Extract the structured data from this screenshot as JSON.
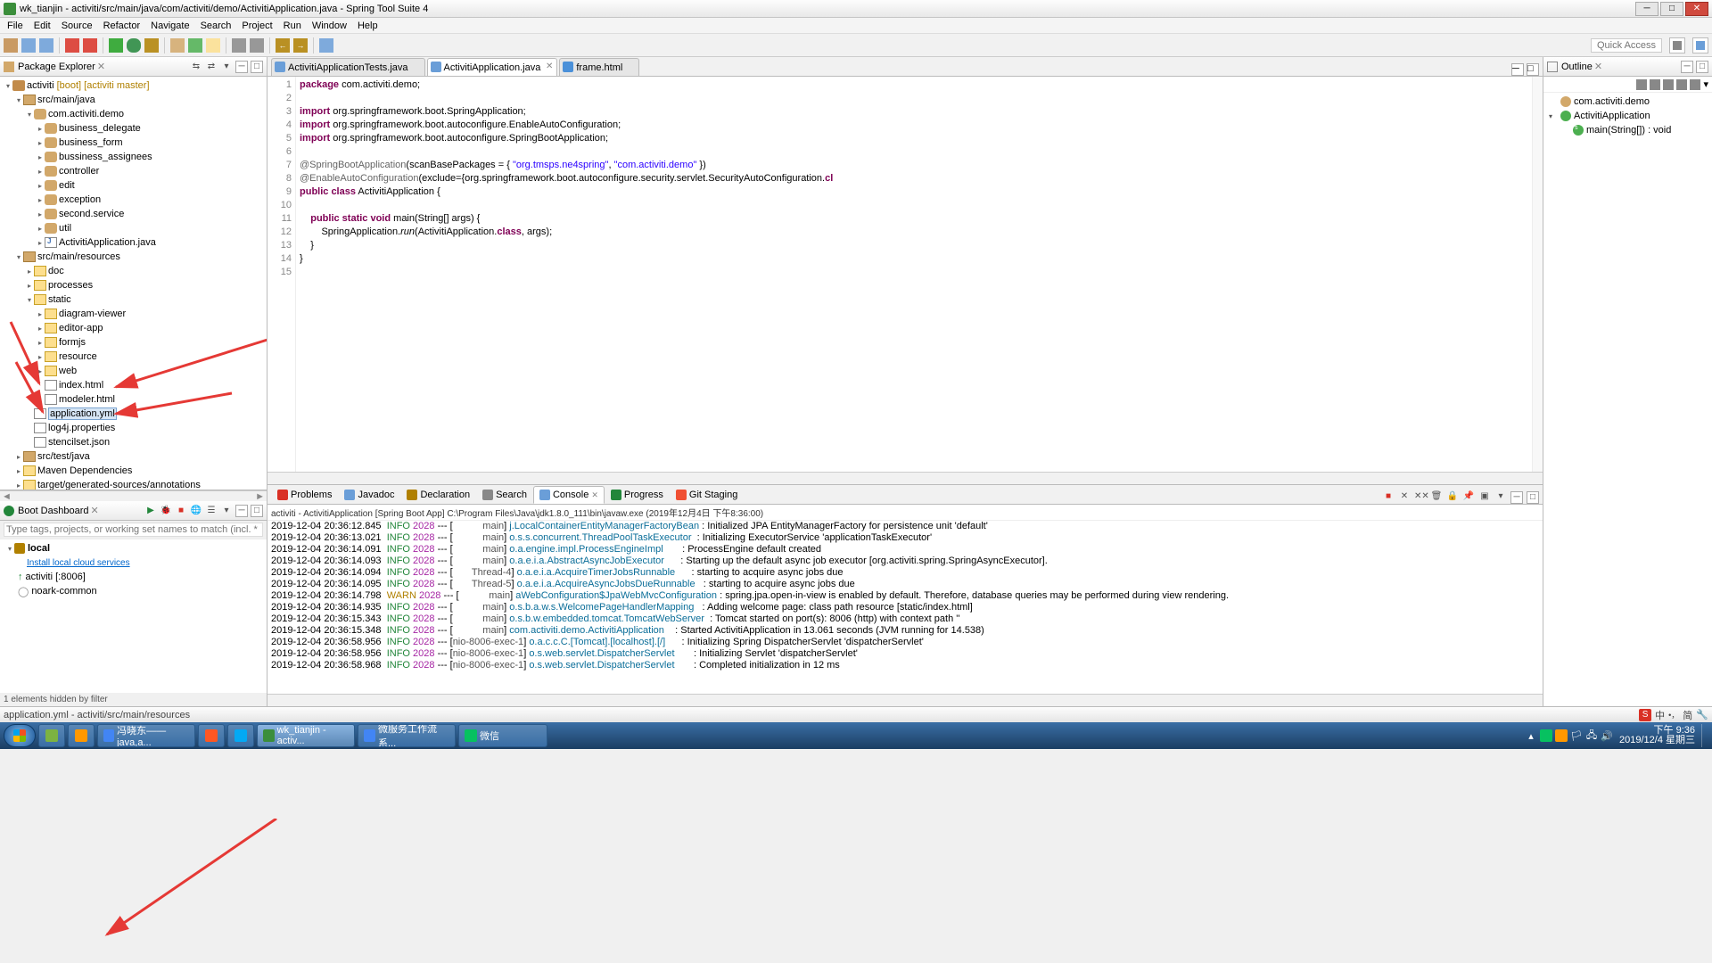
{
  "window": {
    "title": "wk_tianjin - activiti/src/main/java/com/activiti/demo/ActivitiApplication.java - Spring Tool Suite 4"
  },
  "menu": [
    "File",
    "Edit",
    "Source",
    "Refactor",
    "Navigate",
    "Search",
    "Project",
    "Run",
    "Window",
    "Help"
  ],
  "quick_access_placeholder": "Quick Access",
  "pkg_explorer": {
    "title": "Package Explorer",
    "project_label": "activiti",
    "project_tag1": "[boot]",
    "project_tag2": "[activiti master]",
    "nodes": {
      "src_main_java": "src/main/java",
      "pkg": "com.activiti.demo",
      "sub": [
        "business_delegate",
        "business_form",
        "bussiness_assignees",
        "controller",
        "edit",
        "exception",
        "second.service",
        "util"
      ],
      "app_java": "ActivitiApplication.java",
      "src_main_res": "src/main/resources",
      "doc": "doc",
      "processes": "processes",
      "static": "static",
      "static_children": [
        "diagram-viewer",
        "editor-app",
        "formjs",
        "resource",
        "web"
      ],
      "index_html": "index.html",
      "modeler_html": "modeler.html",
      "app_yml": "application.yml",
      "log4j": "log4j.properties",
      "stencil": "stencilset.json",
      "src_test": "src/test/java",
      "maven": "Maven Dependencies",
      "target": "target/generated-sources/annotations"
    }
  },
  "boot_dash": {
    "title": "Boot Dashboard",
    "filter_placeholder": "Type tags, projects, or working set names to match (incl. * and",
    "local": "local",
    "link": "Install local cloud services",
    "apps": [
      {
        "name": "activiti [:8006]",
        "state": "up"
      },
      {
        "name": "noark-common",
        "state": "down"
      }
    ],
    "hidden": "1 elements hidden by filter"
  },
  "editor_tabs": [
    {
      "label": "ActivitiApplicationTests.java",
      "icon": "ic-ja"
    },
    {
      "label": "ActivitiApplication.java",
      "icon": "ic-ja",
      "active": true
    },
    {
      "label": "frame.html",
      "icon": "ic-html"
    }
  ],
  "code_lines": [
    {
      "n": 1,
      "html": "<span class='kw'>package</span> com.activiti.demo;"
    },
    {
      "n": 2,
      "html": ""
    },
    {
      "n": 3,
      "html": "<span class='kw'>import</span> org.springframework.boot.SpringApplication;",
      "fold": true
    },
    {
      "n": 4,
      "html": "<span class='kw'>import</span> org.springframework.boot.autoconfigure.EnableAutoConfiguration;"
    },
    {
      "n": 5,
      "html": "<span class='kw'>import</span> org.springframework.boot.autoconfigure.SpringBootApplication;"
    },
    {
      "n": 6,
      "html": ""
    },
    {
      "n": 7,
      "html": "<span class='ann'>@SpringBootApplication</span>(scanBasePackages = { <span class='str'>\"org.tmsps.ne4spring\"</span>, <span class='str'>\"com.activiti.demo\"</span> })"
    },
    {
      "n": 8,
      "html": "<span class='ann'>@EnableAutoConfiguration</span>(exclude={org.springframework.boot.autoconfigure.security.servlet.SecurityAutoConfiguration.<span class='kw'>cl</span>"
    },
    {
      "n": 9,
      "html": "<span class='kw'>public class</span> ActivitiApplication {"
    },
    {
      "n": 10,
      "html": ""
    },
    {
      "n": 11,
      "html": "    <span class='kw'>public static void</span> main(String[] args) {",
      "fold": true
    },
    {
      "n": 12,
      "html": "        SpringApplication.<i>run</i>(ActivitiApplication.<span class='kw'>class</span>, args);"
    },
    {
      "n": 13,
      "html": "    }"
    },
    {
      "n": 14,
      "html": "}"
    },
    {
      "n": 15,
      "html": ""
    }
  ],
  "bottom_tabs": [
    "Problems",
    "Javadoc",
    "Declaration",
    "Search",
    "Console",
    "Progress",
    "Git Staging"
  ],
  "console_header": "activiti - ActivitiApplication [Spring Boot App] C:\\Program Files\\Java\\jdk1.8.0_111\\bin\\javaw.exe (2019年12月4日 下午8:36:00)",
  "console_lines": [
    {
      "ts": "2019-12-04 20:36:12.845",
      "lvl": "INFO",
      "pid": "2028",
      "thr": "           main",
      "logger": "j.LocalContainerEntityManagerFactoryBean",
      "msg": "Initialized JPA EntityManagerFactory for persistence unit 'default'"
    },
    {
      "ts": "2019-12-04 20:36:13.021",
      "lvl": "INFO",
      "pid": "2028",
      "thr": "           main",
      "logger": "o.s.s.concurrent.ThreadPoolTaskExecutor ",
      "msg": "Initializing ExecutorService 'applicationTaskExecutor'"
    },
    {
      "ts": "2019-12-04 20:36:14.091",
      "lvl": "INFO",
      "pid": "2028",
      "thr": "           main",
      "logger": "o.a.engine.impl.ProcessEngineImpl      ",
      "msg": "ProcessEngine default created"
    },
    {
      "ts": "2019-12-04 20:36:14.093",
      "lvl": "INFO",
      "pid": "2028",
      "thr": "           main",
      "logger": "o.a.e.i.a.AbstractAsyncJobExecutor     ",
      "msg": "Starting up the default async job executor [org.activiti.spring.SpringAsyncExecutor]."
    },
    {
      "ts": "2019-12-04 20:36:14.094",
      "lvl": "INFO",
      "pid": "2028",
      "thr": "       Thread-4",
      "logger": "o.a.e.i.a.AcquireTimerJobsRunnable     ",
      "msg": "starting to acquire async jobs due"
    },
    {
      "ts": "2019-12-04 20:36:14.095",
      "lvl": "INFO",
      "pid": "2028",
      "thr": "       Thread-5",
      "logger": "o.a.e.i.a.AcquireAsyncJobsDueRunnable  ",
      "msg": "starting to acquire async jobs due"
    },
    {
      "ts": "2019-12-04 20:36:14.798",
      "lvl": "WARN",
      "pid": "2028",
      "thr": "           main",
      "logger": "aWebConfiguration$JpaWebMvcConfiguration",
      "msg": "spring.jpa.open-in-view is enabled by default. Therefore, database queries may be performed during view rendering."
    },
    {
      "ts": "2019-12-04 20:36:14.935",
      "lvl": "INFO",
      "pid": "2028",
      "thr": "           main",
      "logger": "o.s.b.a.w.s.WelcomePageHandlerMapping  ",
      "msg": "Adding welcome page: class path resource [static/index.html]"
    },
    {
      "ts": "2019-12-04 20:36:15.343",
      "lvl": "INFO",
      "pid": "2028",
      "thr": "           main",
      "logger": "o.s.b.w.embedded.tomcat.TomcatWebServer ",
      "msg": "Tomcat started on port(s): 8006 (http) with context path ''"
    },
    {
      "ts": "2019-12-04 20:36:15.348",
      "lvl": "INFO",
      "pid": "2028",
      "thr": "           main",
      "logger": "com.activiti.demo.ActivitiApplication   ",
      "msg": "Started ActivitiApplication in 13.061 seconds (JVM running for 14.538)"
    },
    {
      "ts": "2019-12-04 20:36:58.956",
      "lvl": "INFO",
      "pid": "2028",
      "thr": "nio-8006-exec-1",
      "logger": "o.a.c.c.C.[Tomcat].[localhost].[/]     ",
      "msg": "Initializing Spring DispatcherServlet 'dispatcherServlet'"
    },
    {
      "ts": "2019-12-04 20:36:58.956",
      "lvl": "INFO",
      "pid": "2028",
      "thr": "nio-8006-exec-1",
      "logger": "o.s.web.servlet.DispatcherServlet      ",
      "msg": "Initializing Servlet 'dispatcherServlet'"
    },
    {
      "ts": "2019-12-04 20:36:58.968",
      "lvl": "INFO",
      "pid": "2028",
      "thr": "nio-8006-exec-1",
      "logger": "o.s.web.servlet.DispatcherServlet      ",
      "msg": "Completed initialization in 12 ms"
    }
  ],
  "outline": {
    "title": "Outline",
    "pkg": "com.activiti.demo",
    "class": "ActivitiApplication",
    "method": "main(String[]) : void"
  },
  "status": "application.yml - activiti/src/main/resources",
  "ime": {
    "label": "中",
    "sub": "简"
  },
  "taskbar": {
    "items": [
      {
        "label": "",
        "color": "#7cb342",
        "name": "taskbar-app-1"
      },
      {
        "label": "",
        "color": "#ff9800",
        "name": "taskbar-app-2"
      },
      {
        "label": "冯晓东——java,a...",
        "color": "#4285f4",
        "name": "taskbar-chrome-1"
      },
      {
        "label": "",
        "color": "#ff5722",
        "name": "taskbar-app-3"
      },
      {
        "label": "",
        "color": "#03a9f4",
        "name": "taskbar-app-4"
      },
      {
        "label": "wk_tianjin - activ...",
        "color": "#3b8e3b",
        "name": "taskbar-sts",
        "active": true
      },
      {
        "label": "微服务工作流系...",
        "color": "#4285f4",
        "name": "taskbar-chrome-2"
      },
      {
        "label": "微信",
        "color": "#07c160",
        "name": "taskbar-wechat"
      }
    ],
    "clock_time": "下午 9:36",
    "clock_date": "2019/12/4 星期三"
  }
}
